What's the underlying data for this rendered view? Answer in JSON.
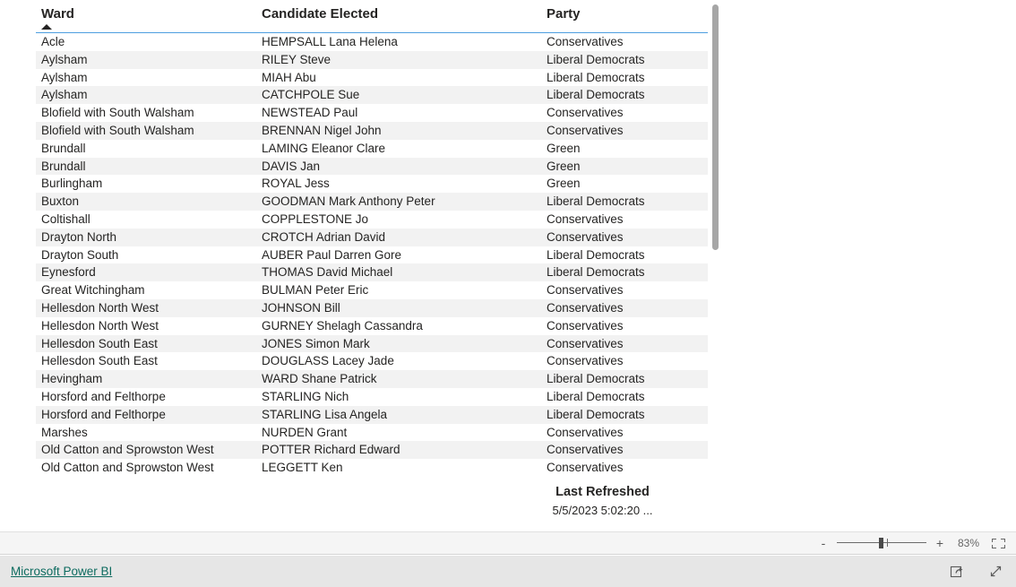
{
  "table": {
    "columns": [
      "Ward",
      "Candidate Elected",
      "Party"
    ],
    "sort": {
      "column": "Ward",
      "direction": "ascending",
      "icon": "sort-ascending-icon"
    },
    "rows": [
      [
        "Acle",
        "HEMPSALL Lana Helena",
        "Conservatives"
      ],
      [
        "Aylsham",
        "RILEY Steve",
        "Liberal Democrats"
      ],
      [
        "Aylsham",
        "MIAH Abu",
        "Liberal Democrats"
      ],
      [
        "Aylsham",
        "CATCHPOLE Sue",
        "Liberal Democrats"
      ],
      [
        "Blofield with South Walsham",
        "NEWSTEAD Paul",
        "Conservatives"
      ],
      [
        "Blofield with South Walsham",
        "BRENNAN Nigel John",
        "Conservatives"
      ],
      [
        "Brundall",
        "LAMING Eleanor Clare",
        "Green"
      ],
      [
        "Brundall",
        "DAVIS Jan",
        "Green"
      ],
      [
        "Burlingham",
        "ROYAL Jess",
        "Green"
      ],
      [
        "Buxton",
        "GOODMAN Mark Anthony Peter",
        "Liberal Democrats"
      ],
      [
        "Coltishall",
        "COPPLESTONE Jo",
        "Conservatives"
      ],
      [
        "Drayton North",
        "CROTCH Adrian David",
        "Conservatives"
      ],
      [
        "Drayton South",
        "AUBER Paul Darren Gore",
        "Liberal Democrats"
      ],
      [
        "Eynesford",
        "THOMAS David Michael",
        "Liberal Democrats"
      ],
      [
        "Great Witchingham",
        "BULMAN Peter Eric",
        "Conservatives"
      ],
      [
        "Hellesdon North West",
        "JOHNSON Bill",
        "Conservatives"
      ],
      [
        "Hellesdon North West",
        "GURNEY Shelagh Cassandra",
        "Conservatives"
      ],
      [
        "Hellesdon South East",
        "JONES Simon Mark",
        "Conservatives"
      ],
      [
        "Hellesdon South East",
        "DOUGLASS Lacey Jade",
        "Conservatives"
      ],
      [
        "Hevingham",
        "WARD Shane Patrick",
        "Liberal Democrats"
      ],
      [
        "Horsford and Felthorpe",
        "STARLING Nich",
        "Liberal Democrats"
      ],
      [
        "Horsford and Felthorpe",
        "STARLING Lisa Angela",
        "Liberal Democrats"
      ],
      [
        "Marshes",
        "NURDEN Grant",
        "Conservatives"
      ],
      [
        "Old Catton and Sprowston West",
        "POTTER Richard Edward",
        "Conservatives"
      ],
      [
        "Old Catton and Sprowston West",
        "LEGGETT Ken",
        "Conservatives"
      ]
    ]
  },
  "last_refreshed": {
    "title": "Last Refreshed",
    "value": "5/5/2023 5:02:20 ..."
  },
  "zoom_bar": {
    "decrease_label": "-",
    "increase_label": "+",
    "percent": "83%",
    "fit_icon": "fit-to-page-icon"
  },
  "footer": {
    "brand_link": "Microsoft Power BI",
    "share_icon": "share-icon",
    "fullscreen_icon": "fullscreen-expand-icon"
  },
  "colors": {
    "header_underline": "#4e9fe0",
    "row_alt": "#f2f2f2",
    "link": "#0d6b5f",
    "footer_bg": "#e6e6e6",
    "zoombar_bg": "#f5f5f5",
    "scrollbar_thumb": "#a6a6a6"
  }
}
